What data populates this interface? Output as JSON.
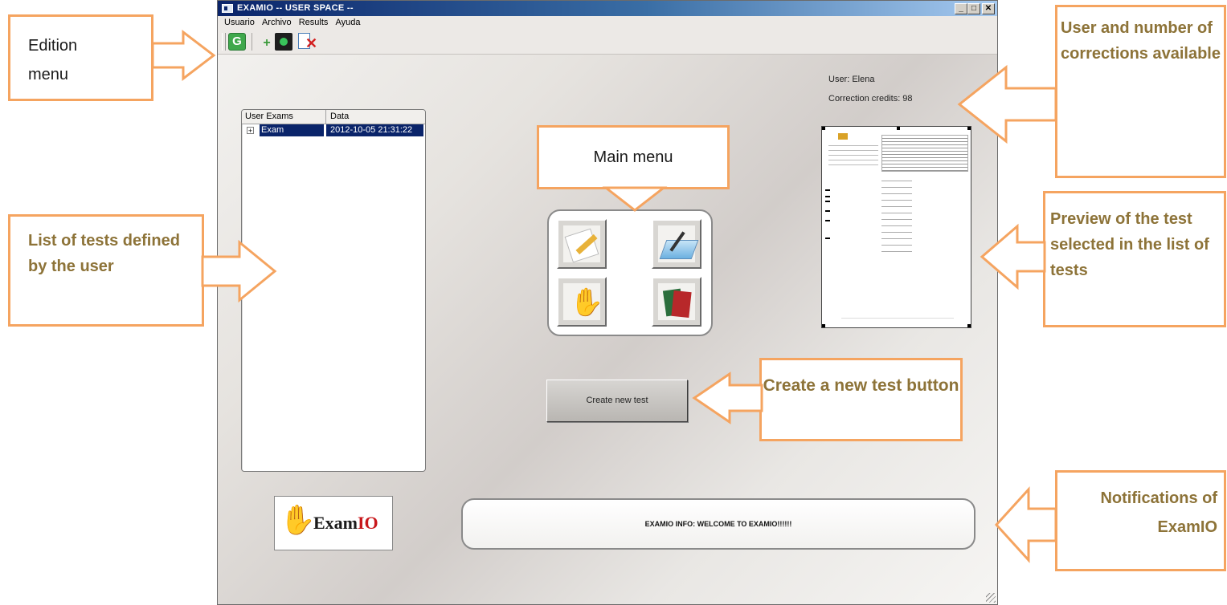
{
  "window": {
    "title": "EXAMIO -- USER SPACE --",
    "controls": {
      "minimize": "_",
      "maximize": "□",
      "close": "✕"
    }
  },
  "menubar": {
    "items": [
      "Usuario",
      "Archivo",
      "Results",
      "Ayuda"
    ]
  },
  "toolbar": {
    "icons": [
      "refresh-icon",
      "add-icon",
      "export-icon",
      "delete-test-icon"
    ],
    "refresh_glyph": "G",
    "add_glyph": "+",
    "delete_glyph": "✕"
  },
  "user": {
    "name_text": "User: Elena",
    "credits_text": "Correction credits: 98"
  },
  "exam_list": {
    "headers": [
      "User Exams",
      "Data"
    ],
    "rows": [
      {
        "name": "Exam",
        "date": "2012-10-05 21:31:22",
        "expander": "+"
      }
    ]
  },
  "main_menu": {
    "buttons": [
      "edit-test-icon",
      "scan-correct-icon",
      "examio-hand-icon",
      "results-icon"
    ]
  },
  "actions": {
    "create_new_test": "Create new test"
  },
  "logo": {
    "exam": "Exam",
    "io": "IO"
  },
  "notifications": {
    "text": "EXAMIO INFO: WELCOME TO EXAMIO!!!!!!"
  },
  "annotations": {
    "edition_menu": "Edition menu",
    "list_of_tests": "List of tests defined by the user",
    "main_menu": "Main menu",
    "user_credits": "User and number of corrections available",
    "preview": "Preview of the test selected in the list of tests",
    "create_test": "Create a new test button",
    "notifications": "Notifications of ExamIO"
  },
  "colors": {
    "annotation_border": "#f5a460",
    "annotation_text_bold": "#8d7338",
    "titlebar": "#0a246a",
    "selection": "#0a246a",
    "logo_io": "#c8171b"
  }
}
